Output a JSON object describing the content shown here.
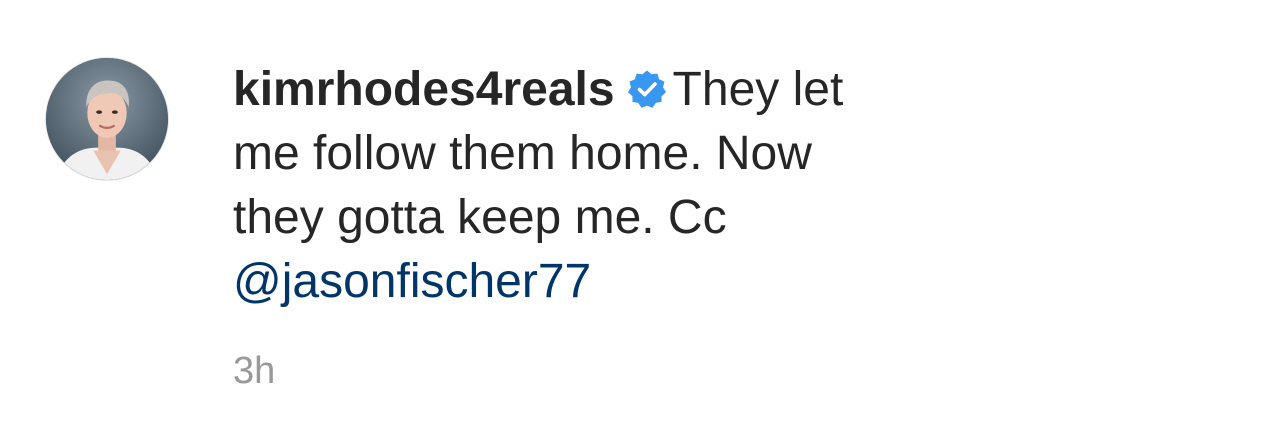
{
  "comment": {
    "username": "kimrhodes4reals",
    "verified": true,
    "text_line1": "They let",
    "text_line2": "me follow them home. Now",
    "text_line3": "they gotta keep me. Cc",
    "mention": "@jasonfischer77",
    "timestamp": "3h"
  },
  "colors": {
    "text": "#262626",
    "mention": "#003569",
    "timestamp": "#999999",
    "verified_badge": "#3897f0"
  },
  "icons": {
    "verified": "verified-badge-icon",
    "avatar": "profile-avatar"
  }
}
